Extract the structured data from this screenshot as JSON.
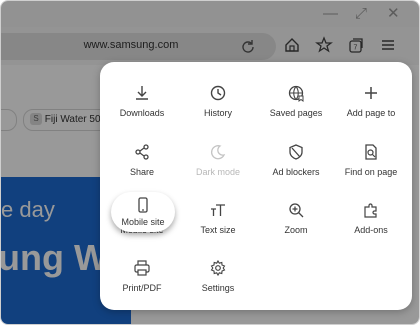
{
  "browser": {
    "url": "www.samsung.com"
  },
  "page": {
    "chip_label": "Fiji Water 500",
    "banner_line1": "e day",
    "banner_line2": "ung W"
  },
  "menu": {
    "items": [
      {
        "label": "Downloads",
        "icon": "download-icon"
      },
      {
        "label": "History",
        "icon": "history-icon"
      },
      {
        "label": "Saved pages",
        "icon": "saved-pages-icon"
      },
      {
        "label": "Add page to",
        "icon": "plus-icon"
      },
      {
        "label": "Share",
        "icon": "share-icon"
      },
      {
        "label": "Dark mode",
        "icon": "moon-icon"
      },
      {
        "label": "Ad blockers",
        "icon": "shield-icon"
      },
      {
        "label": "Find on page",
        "icon": "find-icon"
      },
      {
        "label": "Mobile site",
        "icon": "phone-icon"
      },
      {
        "label": "Text size",
        "icon": "text-size-icon"
      },
      {
        "label": "Zoom",
        "icon": "zoom-icon"
      },
      {
        "label": "Add-ons",
        "icon": "puzzle-icon"
      },
      {
        "label": "Print/PDF",
        "icon": "printer-icon"
      },
      {
        "label": "Settings",
        "icon": "gear-icon"
      }
    ]
  }
}
